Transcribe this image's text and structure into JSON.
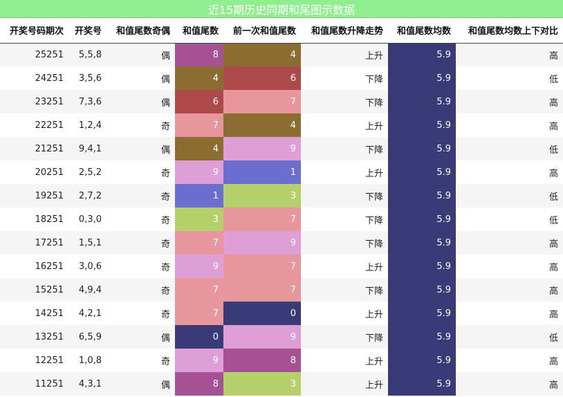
{
  "title": "近15期历史同期和尾图示数据",
  "headers": [
    "开奖号码期次",
    "开奖号",
    "和值尾数奇偶",
    "和值尾数",
    "前一次和值尾数",
    "和值尾数升降走势",
    "和值尾数均数",
    "和值尾数均数上下对比"
  ],
  "digit_colors": {
    "0": "#393b79",
    "1": "#6b6ecf",
    "3": "#b5cf6b",
    "4": "#8c6d31",
    "6": "#ad494a",
    "7": "#e7969c",
    "8": "#a55194",
    "9": "#de9ed6"
  },
  "avg_color": "#393b79",
  "rows": [
    {
      "period": "25251",
      "numbers": "5,5,8",
      "parity": "偶",
      "tail": "8",
      "prev_tail": "4",
      "trend": "上升",
      "avg": "5.9",
      "compare": "高"
    },
    {
      "period": "24251",
      "numbers": "3,5,6",
      "parity": "偶",
      "tail": "4",
      "prev_tail": "6",
      "trend": "下降",
      "avg": "5.9",
      "compare": "低"
    },
    {
      "period": "23251",
      "numbers": "7,3,6",
      "parity": "偶",
      "tail": "6",
      "prev_tail": "7",
      "trend": "下降",
      "avg": "5.9",
      "compare": "高"
    },
    {
      "period": "22251",
      "numbers": "1,2,4",
      "parity": "奇",
      "tail": "7",
      "prev_tail": "4",
      "trend": "上升",
      "avg": "5.9",
      "compare": "高"
    },
    {
      "period": "21251",
      "numbers": "9,4,1",
      "parity": "偶",
      "tail": "4",
      "prev_tail": "9",
      "trend": "下降",
      "avg": "5.9",
      "compare": "低"
    },
    {
      "period": "20251",
      "numbers": "2,5,2",
      "parity": "奇",
      "tail": "9",
      "prev_tail": "1",
      "trend": "上升",
      "avg": "5.9",
      "compare": "高"
    },
    {
      "period": "19251",
      "numbers": "2,7,2",
      "parity": "奇",
      "tail": "1",
      "prev_tail": "3",
      "trend": "下降",
      "avg": "5.9",
      "compare": "低"
    },
    {
      "period": "18251",
      "numbers": "0,3,0",
      "parity": "奇",
      "tail": "3",
      "prev_tail": "7",
      "trend": "下降",
      "avg": "5.9",
      "compare": "低"
    },
    {
      "period": "17251",
      "numbers": "1,5,1",
      "parity": "奇",
      "tail": "7",
      "prev_tail": "9",
      "trend": "下降",
      "avg": "5.9",
      "compare": "高"
    },
    {
      "period": "16251",
      "numbers": "3,0,6",
      "parity": "奇",
      "tail": "9",
      "prev_tail": "7",
      "trend": "上升",
      "avg": "5.9",
      "compare": "高"
    },
    {
      "period": "15251",
      "numbers": "4,9,4",
      "parity": "奇",
      "tail": "7",
      "prev_tail": "7",
      "trend": "下降",
      "avg": "5.9",
      "compare": "高"
    },
    {
      "period": "14251",
      "numbers": "4,2,1",
      "parity": "奇",
      "tail": "7",
      "prev_tail": "0",
      "trend": "上升",
      "avg": "5.9",
      "compare": "高"
    },
    {
      "period": "13251",
      "numbers": "6,5,9",
      "parity": "偶",
      "tail": "0",
      "prev_tail": "9",
      "trend": "下降",
      "avg": "5.9",
      "compare": "低"
    },
    {
      "period": "12251",
      "numbers": "1,0,8",
      "parity": "奇",
      "tail": "9",
      "prev_tail": "8",
      "trend": "上升",
      "avg": "5.9",
      "compare": "高"
    },
    {
      "period": "11251",
      "numbers": "4,3,1",
      "parity": "偶",
      "tail": "8",
      "prev_tail": "3",
      "trend": "上升",
      "avg": "5.9",
      "compare": "高"
    }
  ]
}
